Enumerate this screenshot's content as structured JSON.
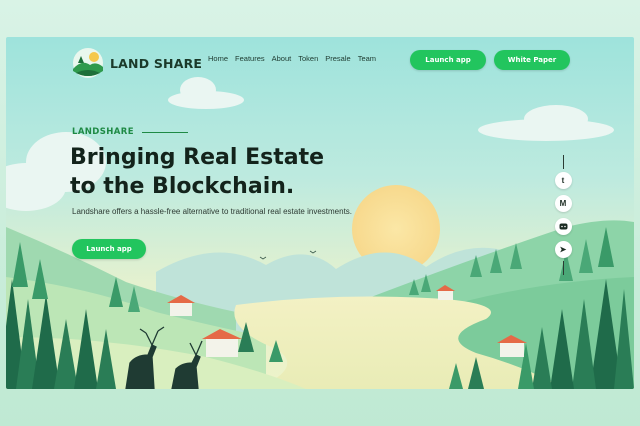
{
  "brand": {
    "name": "LAND SHARE"
  },
  "nav": {
    "items": [
      "Home",
      "Features",
      "About",
      "Token",
      "Presale",
      "Team"
    ]
  },
  "header": {
    "launch_app_label": "Launch app",
    "white_paper_label": "White Paper"
  },
  "hero": {
    "eyebrow": "LANDSHARE",
    "headline_line1": "Bringing Real Estate",
    "headline_line2": "to the Blockchain.",
    "description": "Landshare offers a hassle-free alternative to traditional real estate investments.",
    "cta_label": "Launch app"
  },
  "social": {
    "icons": [
      "twitter-icon",
      "medium-icon",
      "discord-icon",
      "telegram-icon"
    ],
    "glyphs": [
      "t",
      "M",
      "",
      "➤"
    ]
  },
  "colors": {
    "accent": "#22c55e",
    "heading": "#13231b",
    "eyebrow": "#1e8a44",
    "sky": "#9ee3dc"
  }
}
